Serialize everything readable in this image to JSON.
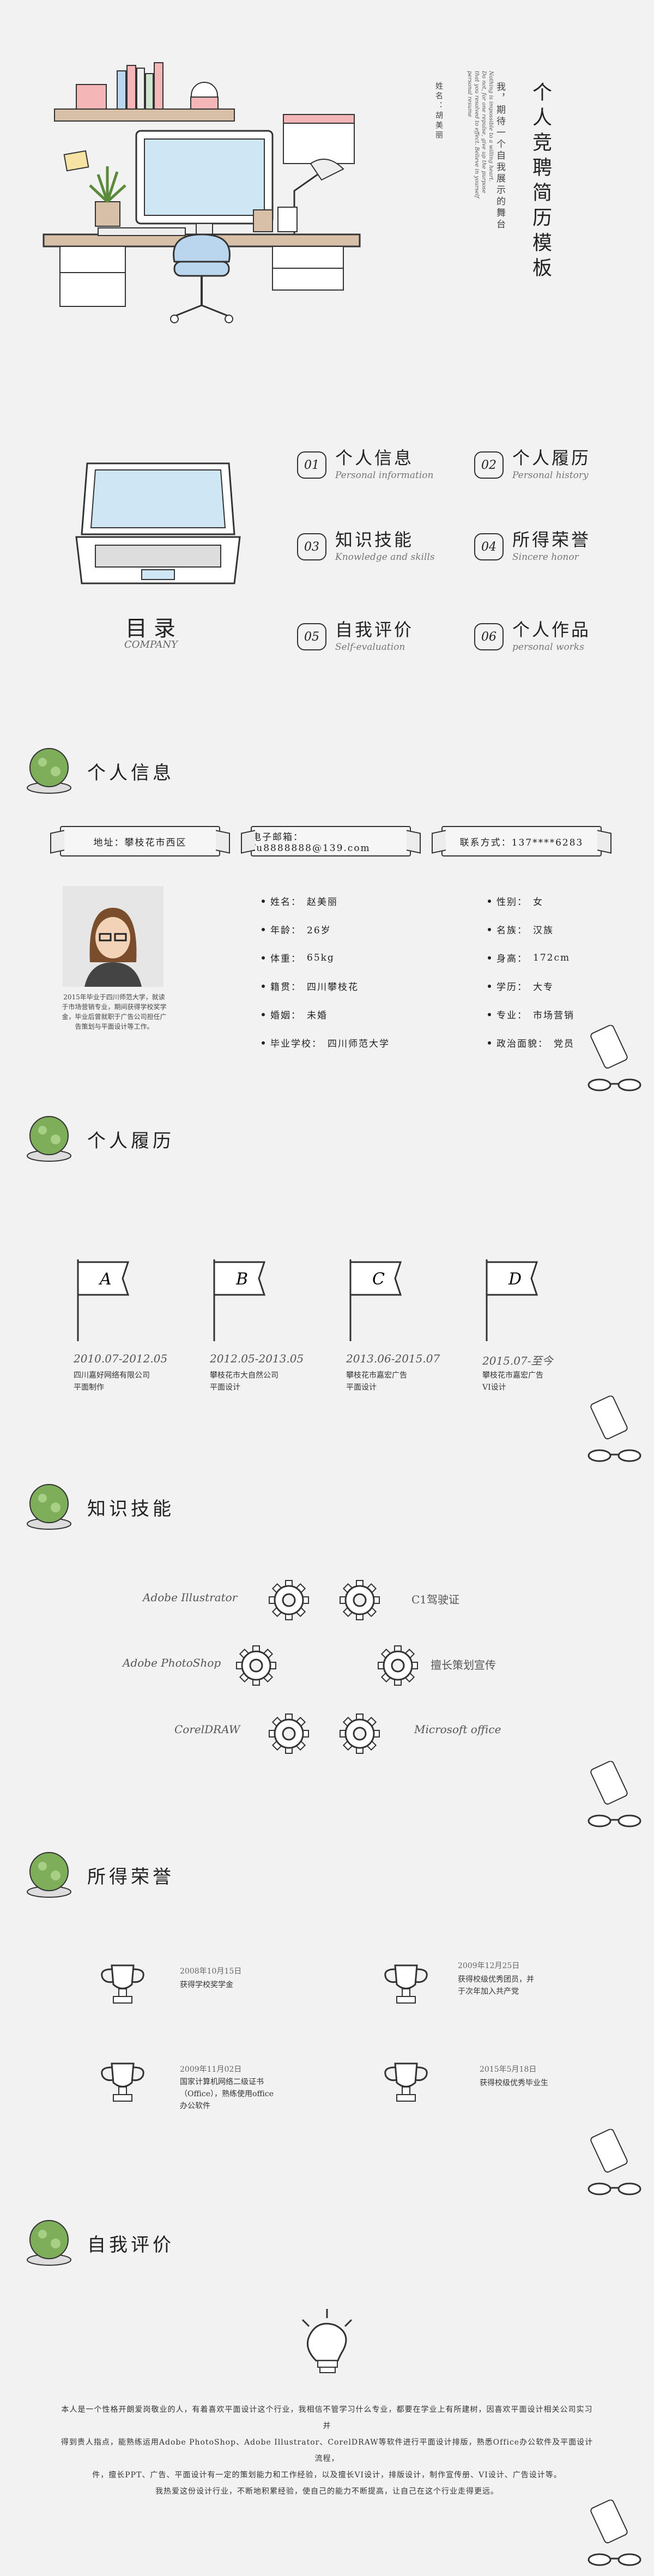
{
  "cover": {
    "title": "个人竞聘简历模板",
    "subtitle": "我，期待一个自我展示的舞台",
    "name_label": "姓名：胡美丽",
    "english_lines": [
      "Nothing is impossible to a willing heart.",
      "Do not, for one repulse, give up the purpose",
      "that you resolved to effect. Believe in yourself",
      "personal resume"
    ]
  },
  "toc": {
    "title": "目录",
    "subtitle": "COMPANY",
    "items": [
      {
        "num": "01",
        "title": "个人信息",
        "sub": "Personal information"
      },
      {
        "num": "02",
        "title": "个人履历",
        "sub": "Personal history"
      },
      {
        "num": "03",
        "title": "知识技能",
        "sub": "Knowledge and skills"
      },
      {
        "num": "04",
        "title": "所得荣誉",
        "sub": "Sincere honor"
      },
      {
        "num": "05",
        "title": "自我评价",
        "sub": "Self-evaluation"
      },
      {
        "num": "06",
        "title": "个人作品",
        "sub": "personal works"
      }
    ]
  },
  "sections": {
    "info": "个人信息",
    "history": "个人履历",
    "skills": "知识技能",
    "honors": "所得荣誉",
    "evaluation": "自我评价"
  },
  "contact": {
    "address": "地址：攀枝花市西区",
    "email": "电子邮箱：fu8888888@139.com",
    "phone": "联系方式：137****6283"
  },
  "avatar_caption": "2015年毕业于四川师范大学，就读于市场营销专业，期间获得学校奖学金，毕业后曾就职于广告公司担任广告策划与平面设计等工作。",
  "personal": {
    "left": [
      {
        "k": "姓名：",
        "v": "赵美丽"
      },
      {
        "k": "年龄：",
        "v": "26岁"
      },
      {
        "k": "体重：",
        "v": "65kg"
      },
      {
        "k": "籍贯：",
        "v": "四川攀枝花"
      },
      {
        "k": "婚姻：",
        "v": "未婚"
      },
      {
        "k": "毕业学校：",
        "v": "四川师范大学"
      }
    ],
    "right": [
      {
        "k": "性别：",
        "v": "女"
      },
      {
        "k": "名族：",
        "v": "汉族"
      },
      {
        "k": "身高：",
        "v": "172cm"
      },
      {
        "k": "学历：",
        "v": "大专"
      },
      {
        "k": "专业：",
        "v": "市场营销"
      },
      {
        "k": "政治面貌：",
        "v": "党员"
      }
    ]
  },
  "history": [
    {
      "flag": "A",
      "date": "2010.07-2012.05",
      "lines": [
        "四川嘉好网络有限公司",
        "平面制作"
      ]
    },
    {
      "flag": "B",
      "date": "2012.05-2013.05",
      "lines": [
        "攀枝花市大自然公司",
        "平面设计"
      ]
    },
    {
      "flag": "C",
      "date": "2013.06-2015.07",
      "lines": [
        "攀枝花市嘉宏广告",
        "平面设计"
      ]
    },
    {
      "flag": "D",
      "date": "2015.07-至今",
      "lines": [
        "攀枝花市嘉宏广告",
        "VI设计"
      ]
    }
  ],
  "skills": {
    "left": [
      "Adobe Illustrator",
      "Adobe PhotoShop",
      "CorelDRAW"
    ],
    "right": [
      "C1驾驶证",
      "擅长策划宣传",
      "Microsoft office"
    ]
  },
  "honors": [
    {
      "date": "2008年10月15日",
      "desc": [
        "获得学校奖学金"
      ]
    },
    {
      "date": "2009年12月25日",
      "desc": [
        "获得校级优秀团员，并",
        "于次年加入共产党"
      ]
    },
    {
      "date": "2009年11月02日",
      "desc": [
        "国家计算机网络二级证书",
        "（Office），熟练使用office",
        "办公软件"
      ]
    },
    {
      "date": "2015年5月18日",
      "desc": [
        "获得校级优秀毕业生"
      ]
    }
  ],
  "evaluation": [
    "本人是一个性格开朗爱岗敬业的人，有着喜欢平面设计这个行业，我相信不管学习什么专业，都要在学业上有所建树，因喜欢平面设计相关公司实习并",
    "得到贵人指点，能熟练运用Adobe PhotoShop、Adobe Illustrator、CorelDRAW等软件进行平面设计排版，熟悉Office办公软件及平面设计流程，",
    "件，擅长PPT、广告、平面设计有一定的策划能力和工作经验，以及擅长VI设计，排版设计，制作宣传册、VI设计、广告设计等。",
    "我热爱这份设计行业，不断地积累经验，使自己的能力不断提高，让自己在这个行业走得更远。"
  ]
}
